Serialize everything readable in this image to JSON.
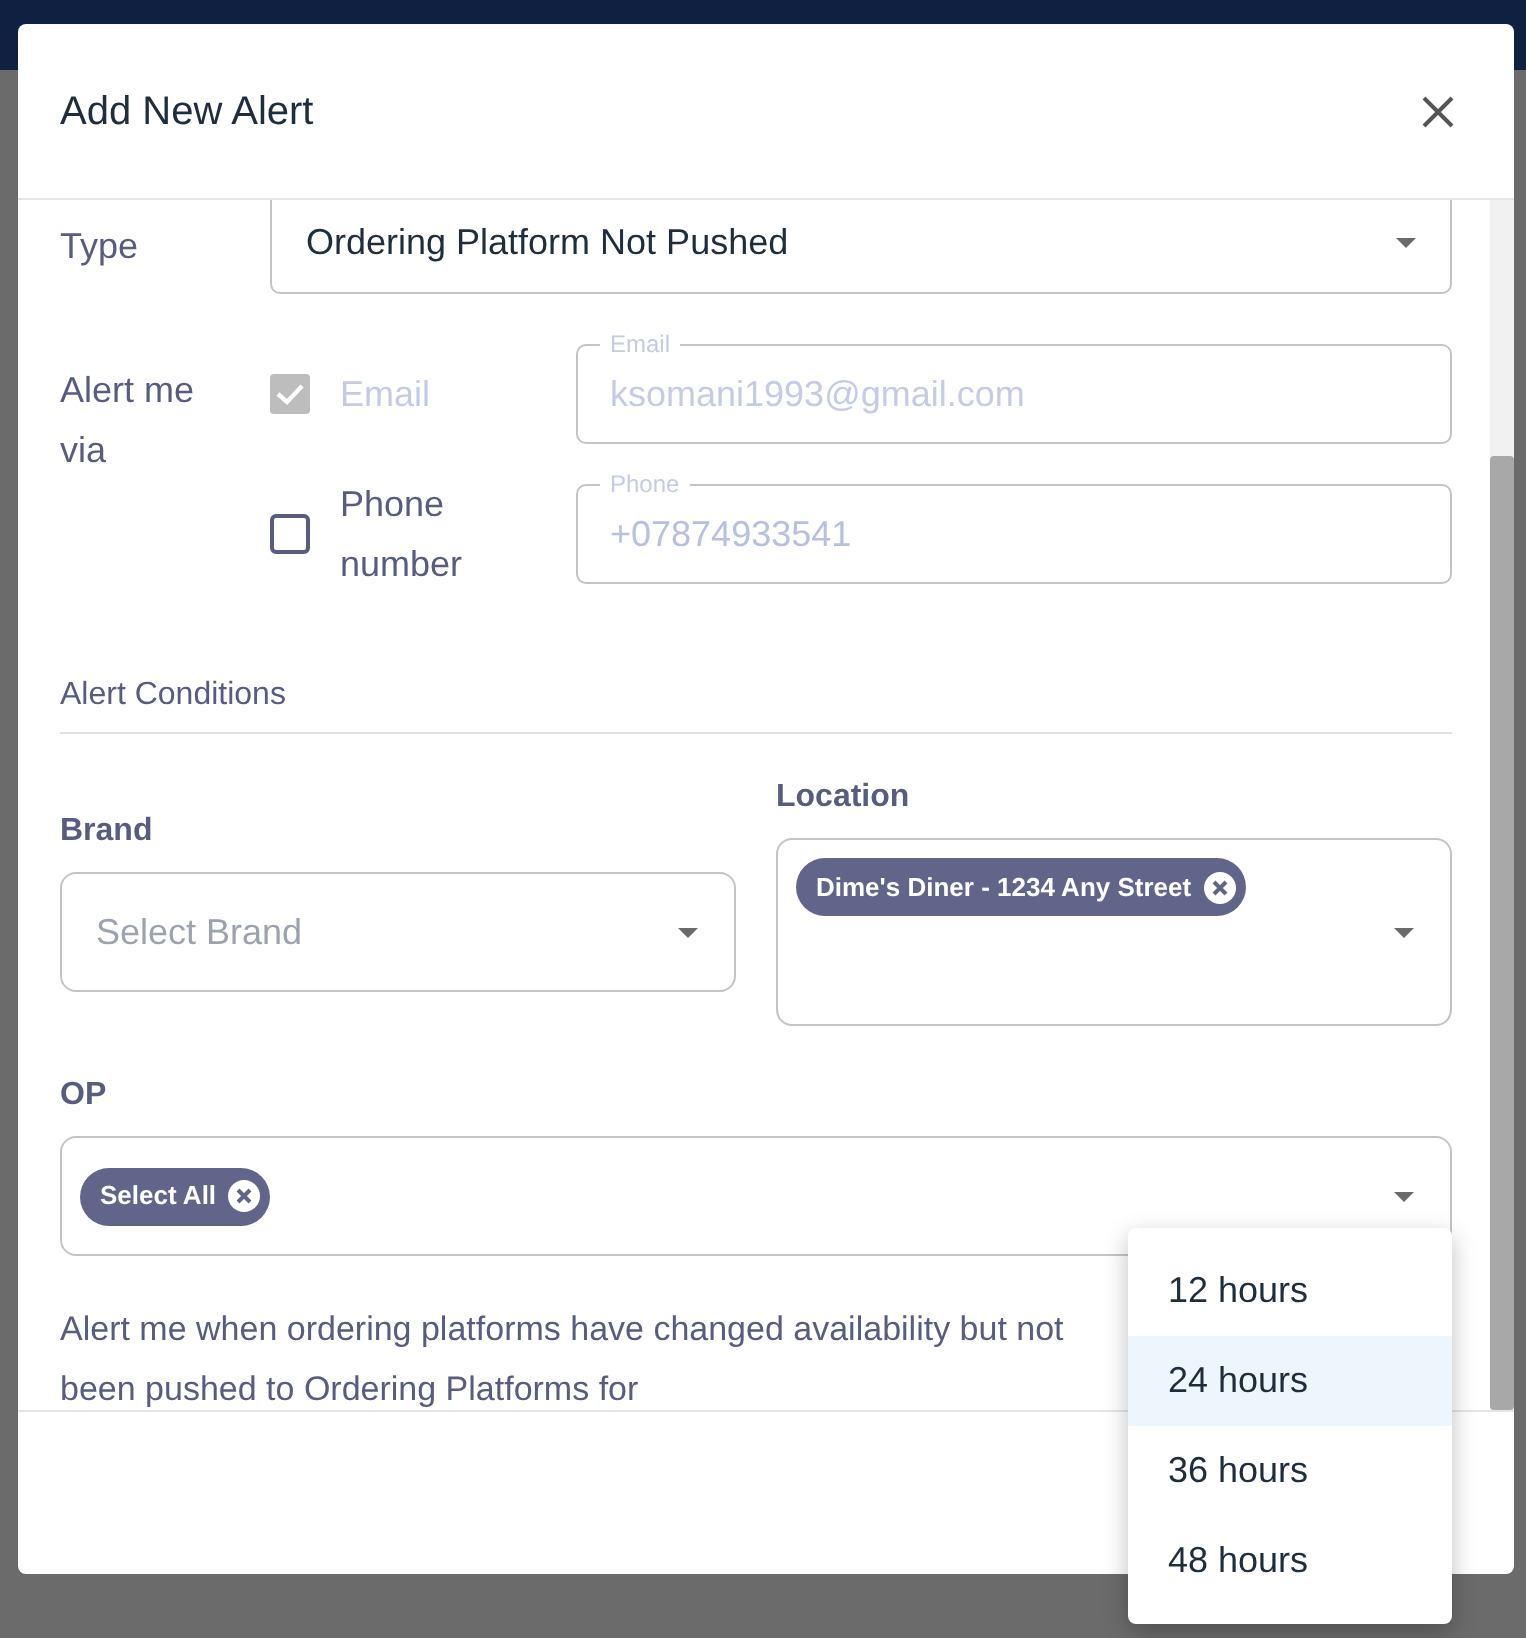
{
  "dialog": {
    "title": "Add New Alert"
  },
  "type_row": {
    "label": "Type",
    "value": "Ordering Platform Not Pushed"
  },
  "alert_via": {
    "label": "Alert me via",
    "channels": [
      {
        "label": "Email",
        "checked": true,
        "disabled": true,
        "field_label": "Email",
        "value": "ksomani1993@gmail.com"
      },
      {
        "label": "Phone number",
        "checked": false,
        "disabled": false,
        "field_label": "Phone",
        "value": "+07874933541"
      }
    ]
  },
  "conditions": {
    "heading": "Alert Conditions",
    "brand": {
      "label": "Brand",
      "placeholder": "Select Brand"
    },
    "location": {
      "label": "Location",
      "chips": [
        "Dime's Diner - 1234 Any Street"
      ]
    },
    "op": {
      "label": "OP",
      "chips": [
        "Select All"
      ]
    }
  },
  "description": "Alert me when ordering platforms have changed availability but not been pushed to Ordering Platforms for",
  "duration_menu": [
    {
      "label": "12 hours",
      "selected": false
    },
    {
      "label": "24 hours",
      "selected": true
    },
    {
      "label": "36 hours",
      "selected": false
    },
    {
      "label": "48 hours",
      "selected": false
    }
  ]
}
